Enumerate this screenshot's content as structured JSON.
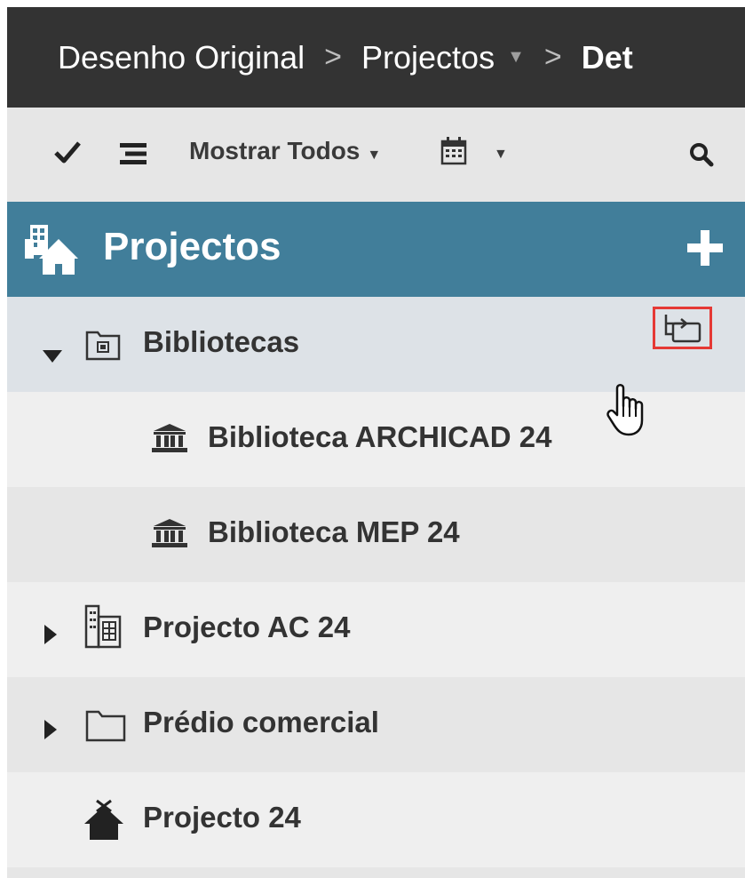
{
  "breadcrumb": {
    "items": [
      "Desenho Original",
      "Projectos",
      "Det"
    ],
    "separator": ">",
    "caret": "▼"
  },
  "toolbar": {
    "filter_label": "Mostrar Todos",
    "caret": "▼"
  },
  "header": {
    "title": "Projectos"
  },
  "tree": [
    {
      "label": "Bibliotecas",
      "icon": "library-folder-icon",
      "expanded": true,
      "selected": true
    },
    {
      "label": "Biblioteca ARCHICAD 24",
      "icon": "library-building-icon"
    },
    {
      "label": "Biblioteca MEP 24",
      "icon": "library-building-icon"
    },
    {
      "label": "Projecto AC 24",
      "icon": "building-icon",
      "expanded": false
    },
    {
      "label": "Prédio comercial",
      "icon": "folder-icon",
      "expanded": false
    },
    {
      "label": "Projecto 24",
      "icon": "house-icon"
    }
  ],
  "colors": {
    "breadcrumb_bg": "#333333",
    "toolbar_bg": "#e6e6e6",
    "header_bg": "#417e9a",
    "selected_row_bg": "#dde2e7",
    "highlight": "#e53935"
  }
}
